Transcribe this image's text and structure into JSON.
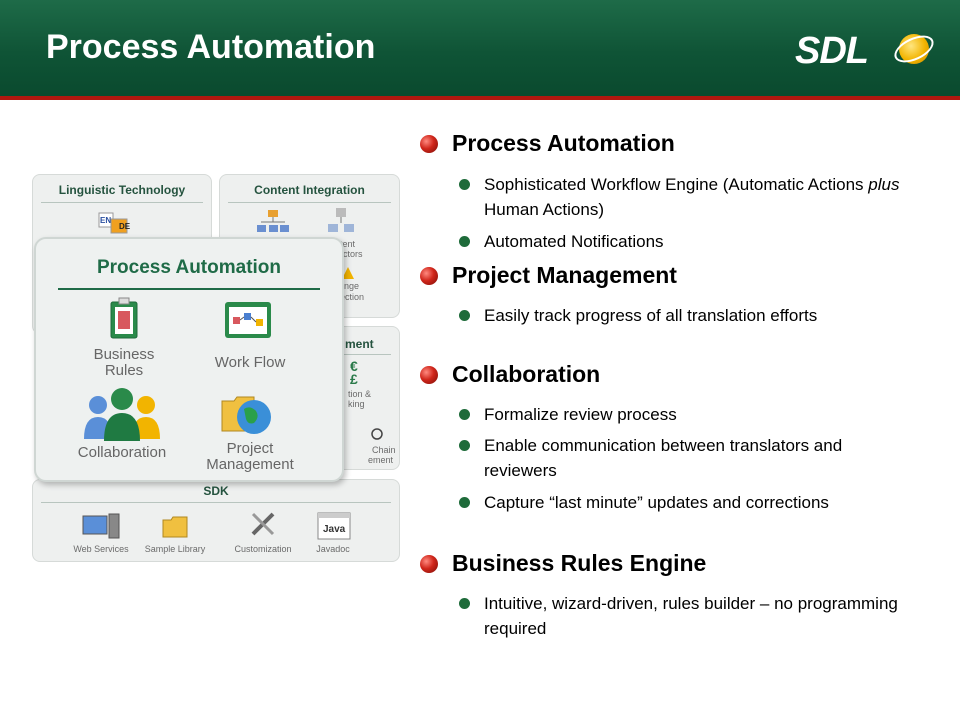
{
  "header": {
    "title": "Process Automation",
    "logo_text": "SDL"
  },
  "diagram": {
    "linguistic_title": "Linguistic Technology",
    "content_title": "Content Integration",
    "content_labels": [
      "tent",
      "ectors",
      "nge",
      "ection"
    ],
    "management_title_fragment": "ment",
    "management_labels": [
      "€",
      "£",
      "tion &",
      "king",
      "Chain",
      "ement"
    ],
    "front_title": "Process Automation",
    "business_rules": "Business\nRules",
    "work_flow": "Work Flow",
    "collaboration": "Collaboration",
    "project_management": "Project\nManagement",
    "sdk_title": "SDK",
    "sdk_items": [
      "Web Services",
      "Sample Library",
      "Customization",
      "Javadoc"
    ],
    "java_label": "Java",
    "ling_flags": [
      "EN",
      "DE"
    ]
  },
  "sections": [
    {
      "title": "Process Automation",
      "items": [
        {
          "before": "Sophisticated Workflow Engine (Automatic Actions ",
          "italic": "plus",
          "after": " Human Actions)"
        },
        {
          "before": "Automated Notifications",
          "italic": "",
          "after": ""
        }
      ]
    },
    {
      "title": "Project Management",
      "items": [
        {
          "before": "Easily track progress of all translation efforts",
          "italic": "",
          "after": ""
        }
      ]
    },
    {
      "title": "Collaboration",
      "items": [
        {
          "before": "Formalize review process",
          "italic": "",
          "after": ""
        },
        {
          "before": "Enable communication between translators and reviewers",
          "italic": "",
          "after": ""
        },
        {
          "before": "Capture “last minute” updates and corrections",
          "italic": "",
          "after": ""
        }
      ]
    },
    {
      "title": "Business Rules Engine",
      "items": [
        {
          "before": "Intuitive, wizard-driven, rules builder – no programming required",
          "italic": "",
          "after": ""
        }
      ]
    }
  ],
  "colors": {
    "header_green": "#0f5436",
    "accent_red": "#b0170f",
    "bullet_green": "#1e6b3a"
  }
}
